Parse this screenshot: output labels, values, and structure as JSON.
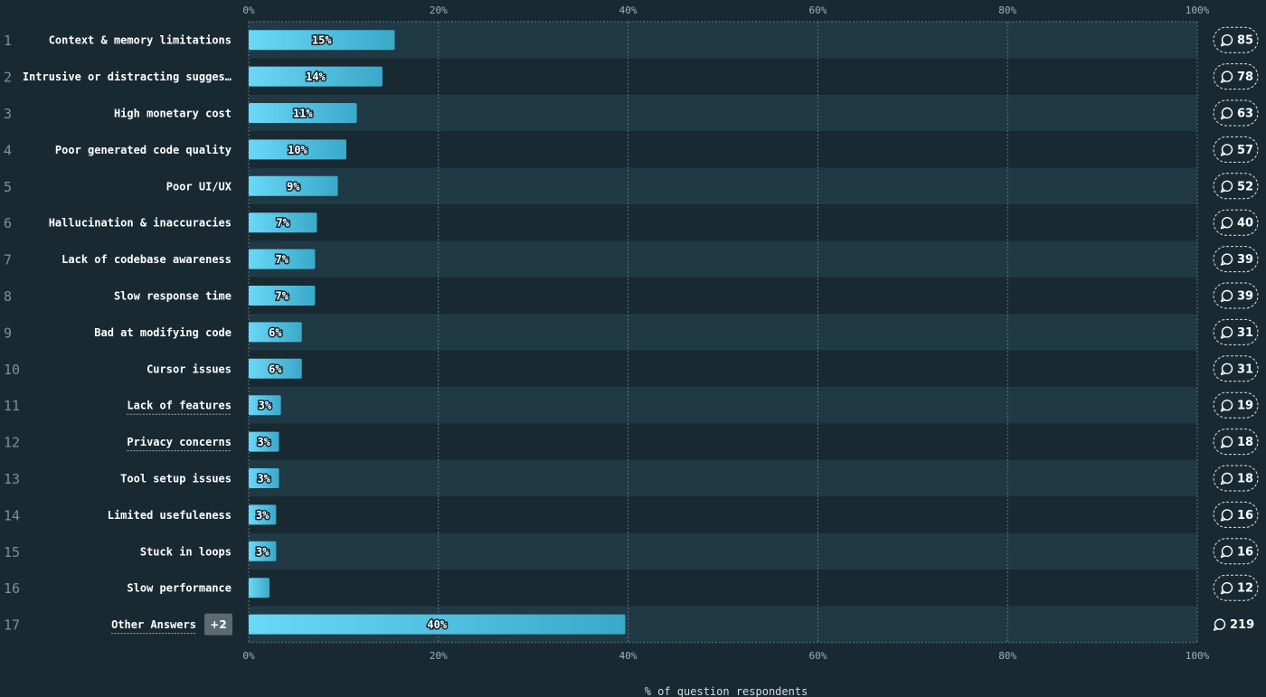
{
  "chart_data": {
    "type": "bar",
    "orientation": "horizontal",
    "xlabel": "% of question respondents",
    "xlim": [
      0,
      100
    ],
    "ticks": [
      "0%",
      "20%",
      "40%",
      "60%",
      "80%",
      "100%"
    ],
    "grid": true,
    "categories": [
      "Context & memory limitations",
      "Intrusive or distracting sugges…",
      "High monetary cost",
      "Poor generated code quality",
      "Poor UI/UX",
      "Hallucination & inaccuracies",
      "Lack of codebase awareness",
      "Slow response time",
      "Bad at modifying code",
      "Cursor issues",
      "Lack of features",
      "Privacy concerns",
      "Tool setup issues",
      "Limited usefuleness",
      "Stuck in loops",
      "Slow performance",
      "Other Answers"
    ],
    "ranks": [
      "1",
      "2",
      "3",
      "4",
      "5",
      "6",
      "7",
      "8",
      "9",
      "10",
      "11",
      "12",
      "13",
      "14",
      "15",
      "16",
      "17"
    ],
    "values": [
      15.4,
      14.1,
      11.4,
      10.3,
      9.4,
      7.2,
      7.0,
      7.0,
      5.6,
      5.6,
      3.4,
      3.2,
      3.2,
      2.9,
      2.9,
      2.2,
      39.7
    ],
    "value_labels": [
      "15%",
      "14%",
      "11%",
      "10%",
      "9%",
      "7%",
      "7%",
      "7%",
      "6%",
      "6%",
      "3%",
      "3%",
      "3%",
      "3%",
      "3%",
      "",
      "40%"
    ],
    "counts": [
      "85",
      "78",
      "63",
      "57",
      "52",
      "40",
      "39",
      "39",
      "31",
      "31",
      "19",
      "18",
      "18",
      "16",
      "16",
      "12",
      "219"
    ],
    "underlined": [
      false,
      false,
      false,
      false,
      false,
      false,
      false,
      false,
      false,
      false,
      true,
      true,
      false,
      false,
      false,
      false,
      true
    ],
    "other_badge": "+2",
    "colors": {
      "background": "#182932",
      "row_alt": "#1f3945",
      "bar_start": "#6ad8f7",
      "bar_end": "#3aa9c9",
      "grid": "#5e7580",
      "badge_bg": "#5b6a70"
    }
  }
}
